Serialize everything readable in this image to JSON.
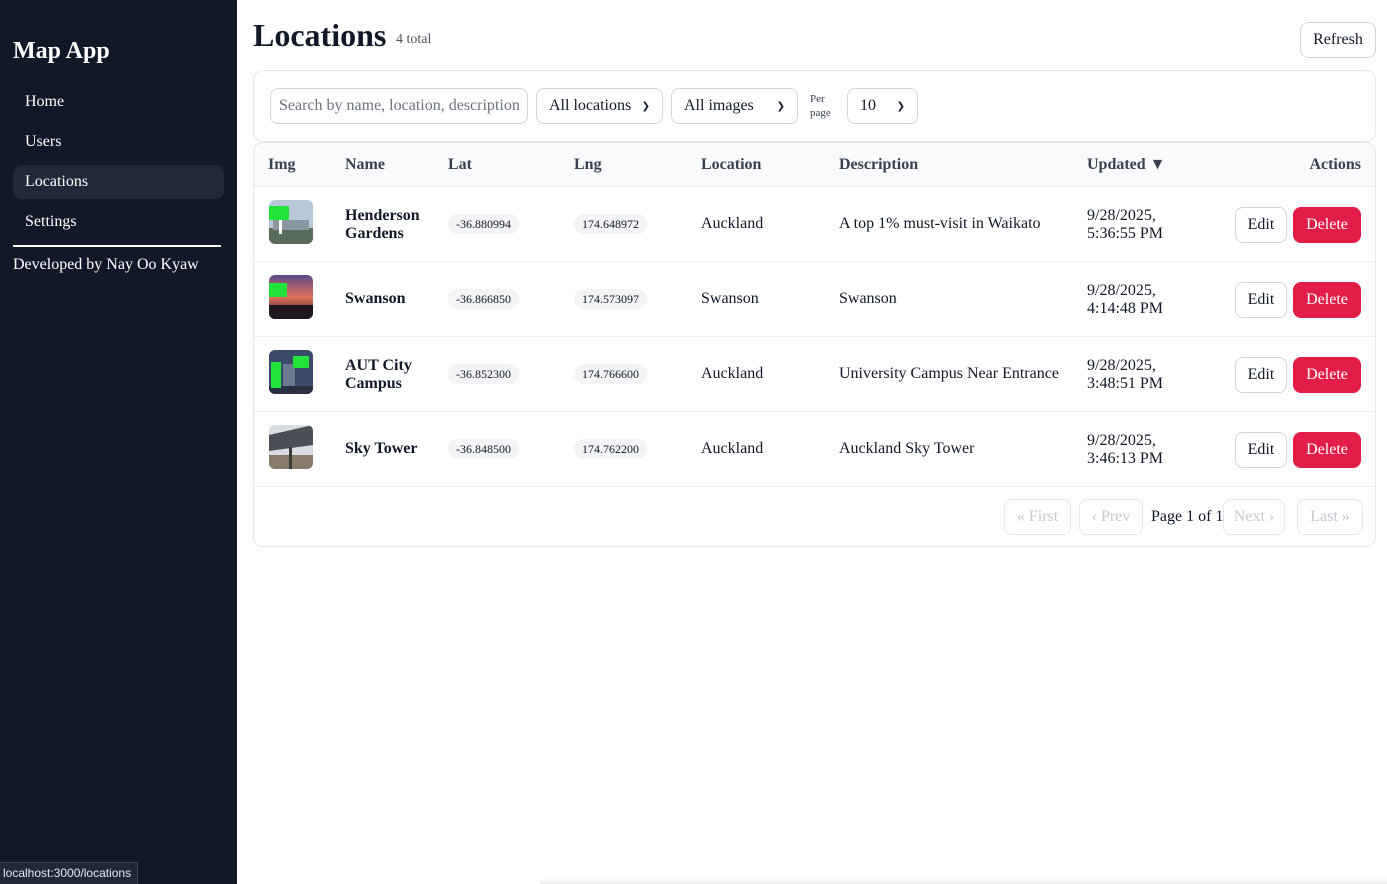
{
  "sidebar": {
    "brand": "Map App",
    "nav": [
      {
        "label": "Home",
        "active": false
      },
      {
        "label": "Users",
        "active": false
      },
      {
        "label": "Locations",
        "active": true
      },
      {
        "label": "Settings",
        "active": false
      }
    ],
    "credit": "Developed by Nay Oo Kyaw"
  },
  "status_bar": "localhost:3000/locations",
  "header": {
    "title": "Locations",
    "total": "4 total",
    "refresh_label": "Refresh"
  },
  "filters": {
    "search_placeholder": "Search by name, location, description",
    "location_filter": "All locations",
    "image_filter": "All images",
    "per_page_label": "Per page",
    "per_page_value": "10"
  },
  "table": {
    "columns": [
      "Img",
      "Name",
      "Lat",
      "Lng",
      "Location",
      "Description",
      "Updated ▼",
      "Actions"
    ],
    "rows": [
      {
        "name": "Henderson Gardens",
        "lat": "-36.880994",
        "lng": "174.648972",
        "location": "Auckland",
        "description": "A top 1% must-visit in Waikato",
        "updated": "9/28/2025, 5:36:55 PM"
      },
      {
        "name": "Swanson",
        "lat": "-36.866850",
        "lng": "174.573097",
        "location": "Swanson",
        "description": "Swanson",
        "updated": "9/28/2025, 4:14:48 PM"
      },
      {
        "name": "AUT City Campus",
        "lat": "-36.852300",
        "lng": "174.766600",
        "location": "Auckland",
        "description": "University Campus Near Entrance",
        "updated": "9/28/2025, 3:48:51 PM"
      },
      {
        "name": "Sky Tower",
        "lat": "-36.848500",
        "lng": "174.762200",
        "location": "Auckland",
        "description": "Auckland Sky Tower",
        "updated": "9/28/2025, 3:46:13 PM"
      }
    ],
    "edit_label": "Edit",
    "delete_label": "Delete"
  },
  "pagination": {
    "first": "« First",
    "prev": "‹ Prev",
    "info": "Page 1 of 1",
    "next": "Next ›",
    "last": "Last »"
  },
  "colors": {
    "sidebar_bg": "#111827",
    "delete_red": "#e11d48",
    "accent_green": "#22e33a"
  }
}
